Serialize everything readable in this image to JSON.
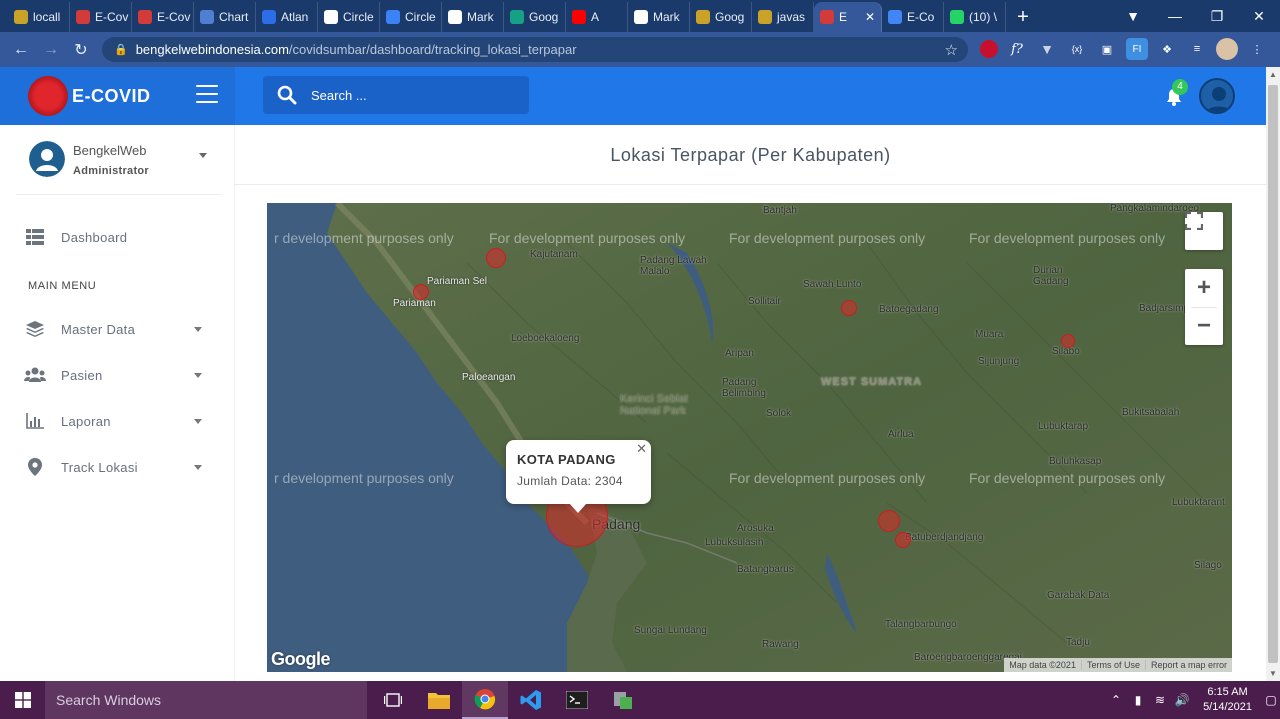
{
  "browser": {
    "tabs": [
      {
        "label": "locall",
        "color": "#c9a227"
      },
      {
        "label": "E-Cov",
        "color": "#d33b3b"
      },
      {
        "label": "E-Cov",
        "color": "#d33b3b"
      },
      {
        "label": "Chart",
        "color": "#4f7fd1"
      },
      {
        "label": "Atlan",
        "color": "#2b6ee8"
      },
      {
        "label": "Circle",
        "color": "#ffffff"
      },
      {
        "label": "Circle",
        "color": "#3b82f6"
      },
      {
        "label": "Mark",
        "color": "#ffffff"
      },
      {
        "label": "Goog",
        "color": "#16a085"
      },
      {
        "label": "A",
        "color": "#ff0000"
      },
      {
        "label": "Mark",
        "color": "#ffffff"
      },
      {
        "label": "Goog",
        "color": "#c9a227"
      },
      {
        "label": "javas",
        "color": "#c9a227"
      },
      {
        "label": "E",
        "color": "#d33b3b",
        "active": true
      },
      {
        "label": "E-Co",
        "color": "#4285f4"
      },
      {
        "label": "(10) \\",
        "color": "#25d366"
      }
    ],
    "new_tab": "+",
    "url_host": "bengkelwebindonesia.com",
    "url_path": "/covidsumbar/dashboard/tracking_lokasi_terpapar"
  },
  "app": {
    "brand_name": "E-COVID",
    "search_placeholder": "Search ...",
    "notification_count": "4"
  },
  "sidebar": {
    "user_name": "BengkelWeb",
    "user_role": "Administrator",
    "dashboard_label": "Dashboard",
    "menu_header": "MAIN MENU",
    "items": [
      {
        "label": "Master Data"
      },
      {
        "label": "Pasien"
      },
      {
        "label": "Laporan"
      },
      {
        "label": "Track Lokasi"
      }
    ]
  },
  "page": {
    "title": "Lokasi Terpapar (Per Kabupaten)"
  },
  "map": {
    "watermark": "For development purposes only",
    "watermark_cut": "r development purposes only",
    "infowindow": {
      "title": "KOTA PADANG",
      "body": "Jumlah Data: 2304"
    },
    "places": {
      "pariaman_sel": "Pariaman Sel",
      "pariaman": "Pariaman",
      "kajutanam": "Kajutanam",
      "padang_lawah": "Padang Lawah Malalo",
      "bantjah": "Bantjah",
      "pangkalan": "Pangkalamindaroeo",
      "sawah_lunto": "Sawah Lunto",
      "batoegadang": "Batoegadang",
      "sollitair": "Sollitair",
      "durian": "Durian Gadang",
      "badjarsimp": "Badjarsimp",
      "muara": "Muara",
      "sijunjung": "Sijunjung",
      "silabo": "Silabo",
      "loeboekalo": "Loeboekaloeng",
      "paloeangan": "Paloeangan",
      "aripan": "Aripan",
      "padang_belimbing": "Padang Belimbing",
      "west_sumatra": "WEST SUMATRA",
      "kerinci": "Kerinci Seblat National Park",
      "solok": "Solok",
      "bukitsabalah": "Bukitsabalah",
      "lubuktarap": "Lubuktarap",
      "airlua": "Airlua",
      "buluhkasap": "Buluhkasap",
      "lubuktarant": "Lubuktarant",
      "padang": "Padang",
      "arosuka": "Arosuka",
      "lubuksulasih": "Lubuksulasih",
      "batuberdjandjang": "Batuberdjandjang",
      "batangbarus": "Batangbarus",
      "silago": "Silago",
      "garabak": "Garabak Data",
      "sungai_lundang": "Sungai Lundang",
      "talang": "Talangbarbungo",
      "tadju": "Tadju",
      "rawang": "Rawang",
      "baroeng": "Baroengbaroenggaregai"
    },
    "google": "Google",
    "attribution": [
      "Map data ©2021",
      "Terms of Use",
      "Report a map error"
    ]
  },
  "taskbar": {
    "search_placeholder": "Search Windows",
    "time": "6:15 AM",
    "date": "5/14/2021"
  }
}
